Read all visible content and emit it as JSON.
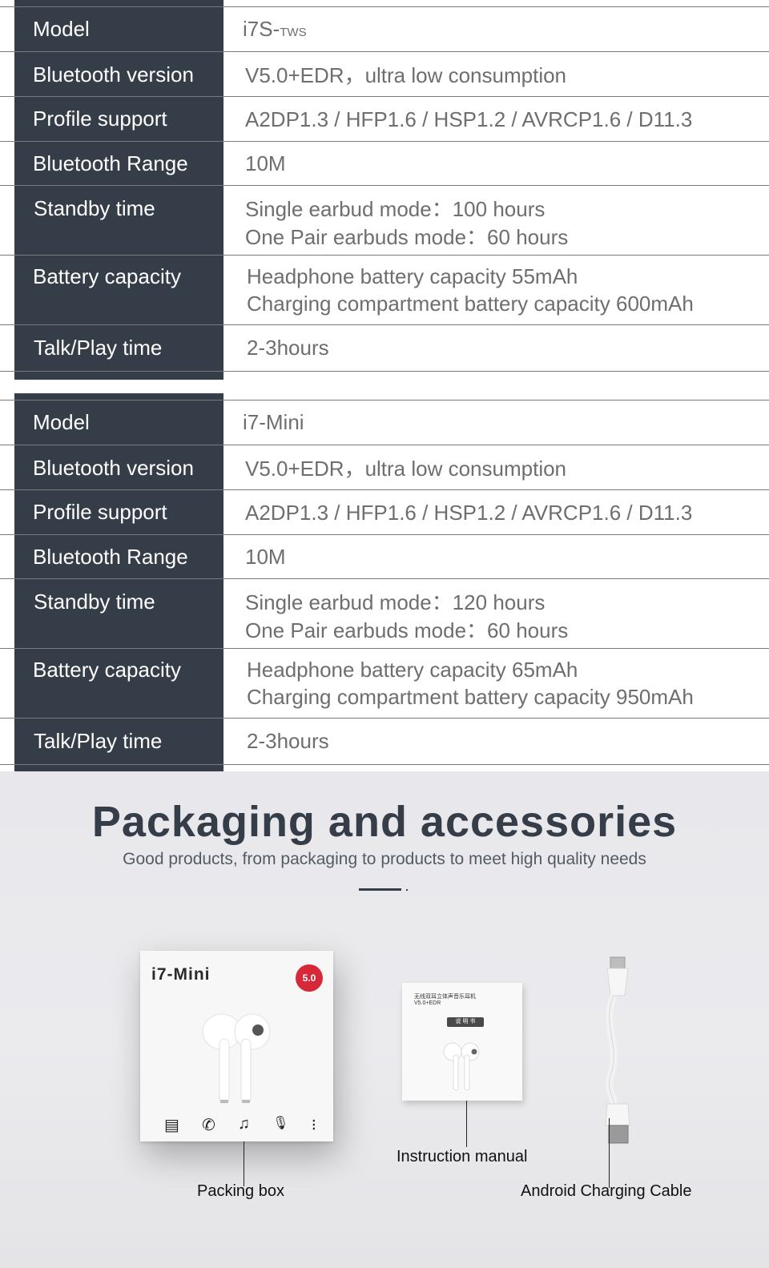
{
  "tables": [
    {
      "rows": [
        {
          "label": "Model",
          "value_lines": [
            "i7S-"
          ],
          "value_suffix_smallcaps": "tws"
        },
        {
          "label": "Bluetooth version",
          "value_lines": [
            "V5.0+EDR，ultra low consumption"
          ]
        },
        {
          "label": "Profile support",
          "value_lines": [
            "A2DP1.3 / HFP1.6 / HSP1.2 / AVRCP1.6 / D11.3"
          ]
        },
        {
          "label": "Bluetooth Range",
          "value_lines": [
            "10M"
          ]
        },
        {
          "label": "Standby time",
          "value_lines": [
            "Single earbud mode：100 hours",
            "One Pair earbuds mode：60 hours"
          ]
        },
        {
          "label": "Battery capacity",
          "value_lines": [
            "Headphone battery capacity 55mAh",
            "Charging compartment battery capacity 600mAh"
          ]
        },
        {
          "label": "Talk/Play time",
          "value_lines": [
            "2-3hours"
          ]
        }
      ]
    },
    {
      "rows": [
        {
          "label": "Model",
          "value_lines": [
            "i7-Mini"
          ]
        },
        {
          "label": "Bluetooth version",
          "value_lines": [
            "V5.0+EDR，ultra low consumption"
          ]
        },
        {
          "label": "Profile support",
          "value_lines": [
            "A2DP1.3 / HFP1.6 / HSP1.2 / AVRCP1.6 / D11.3"
          ]
        },
        {
          "label": "Bluetooth Range",
          "value_lines": [
            "10M"
          ]
        },
        {
          "label": "Standby time",
          "value_lines": [
            "Single earbud mode：120 hours",
            "One Pair earbuds mode：60 hours"
          ]
        },
        {
          "label": "Battery capacity",
          "value_lines": [
            "Headphone battery capacity 65mAh",
            "Charging compartment battery capacity 950mAh"
          ]
        },
        {
          "label": "Talk/Play time",
          "value_lines": [
            "2-3hours"
          ]
        }
      ]
    }
  ],
  "packaging": {
    "title": "Packaging and accessories",
    "subtitle": "Good products, from packaging to products to meet high quality needs",
    "box": {
      "model": "i7-Mini",
      "badge": "5.0",
      "icons": [
        "battery-icon",
        "phone-icon",
        "music-note-icon",
        "microphone-icon",
        "voice-icon"
      ],
      "icon_glyphs": [
        "▤",
        "✆",
        "♫",
        "🎙",
        "⁝"
      ]
    },
    "manual": {
      "line1": "无线双耳立体声音乐耳机",
      "line2": "V5.0+EDR",
      "tag": "说 明 书"
    },
    "captions": {
      "box": "Packing box",
      "manual": "Instruction manual",
      "cable": "Android Charging Cable"
    }
  },
  "colors": {
    "label_bg": "#343d48",
    "value_text": "#6e6e6e",
    "title_text": "#343d48",
    "badge": "#d7283a"
  }
}
